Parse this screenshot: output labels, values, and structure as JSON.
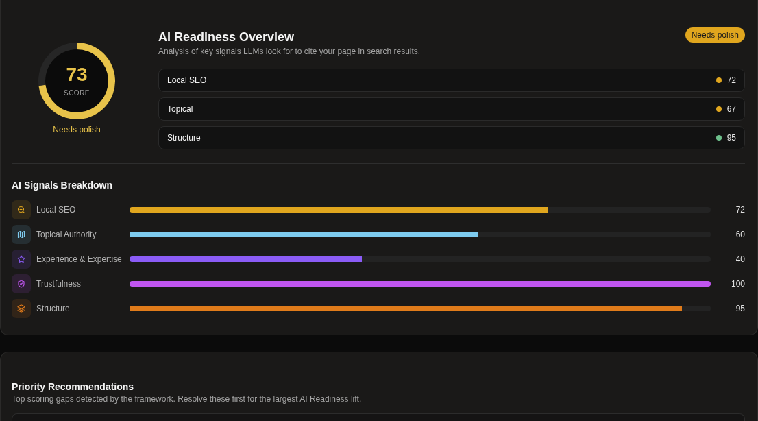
{
  "overview": {
    "gauge": {
      "score": "73",
      "caption": "SCORE",
      "status": "Needs polish",
      "chart_data": {
        "type": "donut",
        "values": [
          73,
          27
        ],
        "colors": [
          "#e8c34a",
          "#262626"
        ]
      }
    },
    "title": "AI Readiness Overview",
    "badge": "Needs polish",
    "subtitle": "Analysis of key signals LLMs look for to cite your page in search results.",
    "metrics": [
      {
        "label": "Local SEO",
        "value": "72",
        "color": "#e0a61e"
      },
      {
        "label": "Topical",
        "value": "67",
        "color": "#e0a61e"
      },
      {
        "label": "Structure",
        "value": "95",
        "color": "#6dbf8b"
      }
    ]
  },
  "breakdown": {
    "title": "AI Signals Breakdown",
    "signals": [
      {
        "label": "Local SEO",
        "value": "72",
        "level": 0.72,
        "color": "#e0a61e"
      },
      {
        "label": "Topical Authority",
        "value": "60",
        "level": 0.6,
        "color": "#7ecbef"
      },
      {
        "label": "Experience & Expertise",
        "value": "40",
        "level": 0.4,
        "color": "#8b5cf6"
      },
      {
        "label": "Trustfulness",
        "value": "100",
        "level": 1,
        "color": "#c055f0"
      },
      {
        "label": "Structure",
        "value": "95",
        "level": 0.95,
        "color": "#e07b1a"
      }
    ]
  },
  "recommendations": {
    "title": "Priority Recommendations",
    "subtitle": "Top scoring gaps detected by the framework. Resolve these first for the largest AI Readiness lift."
  }
}
